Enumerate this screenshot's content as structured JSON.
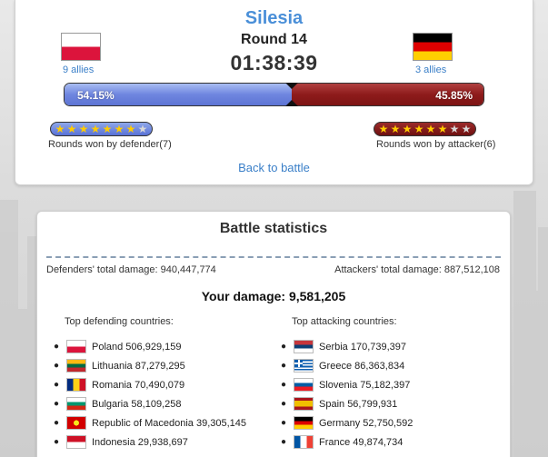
{
  "battle": {
    "region": "Silesia",
    "round": "Round 14",
    "timer": "01:38:39",
    "defender_allies": "9 allies",
    "attacker_allies": "3 allies",
    "defender_percent": "54.15%",
    "attacker_percent": "45.85%",
    "defender_share": 0.5415,
    "defender_rounds_label": "Rounds won by defender(7)",
    "attacker_rounds_label": "Rounds won by attacker(6)",
    "defender_rounds": 7,
    "attacker_rounds": 6,
    "max_rounds": 8,
    "back_link": "Back to battle",
    "colors": {
      "defender": "#5d74d4",
      "attacker": "#7d1414",
      "link": "#3a7fc8"
    }
  },
  "stats": {
    "title": "Battle statistics",
    "defenders_total": "Defenders' total damage: 940,447,774",
    "attackers_total": "Attackers' total damage: 887,512,108",
    "your_damage": "Your damage: 9,581,205",
    "top_defending_label": "Top defending countries:",
    "top_attacking_label": "Top attacking countries:",
    "defending": [
      {
        "text": "Poland 506,929,159",
        "flag": "poland"
      },
      {
        "text": "Lithuania 87,279,295",
        "flag": "lithuania"
      },
      {
        "text": "Romania 70,490,079",
        "flag": "romania"
      },
      {
        "text": "Bulgaria 58,109,258",
        "flag": "bulgaria"
      },
      {
        "text": "Republic of Macedonia 39,305,145",
        "flag": "macedonia"
      },
      {
        "text": "Indonesia 29,938,697",
        "flag": "indonesia"
      }
    ],
    "attacking": [
      {
        "text": "Serbia 170,739,397",
        "flag": "serbia"
      },
      {
        "text": "Greece 86,363,834",
        "flag": "greece"
      },
      {
        "text": "Slovenia 75,182,397",
        "flag": "slovenia"
      },
      {
        "text": "Spain 56,799,931",
        "flag": "spain"
      },
      {
        "text": "Germany 52,750,592",
        "flag": "germany"
      },
      {
        "text": "France 49,874,734",
        "flag": "france"
      }
    ]
  }
}
